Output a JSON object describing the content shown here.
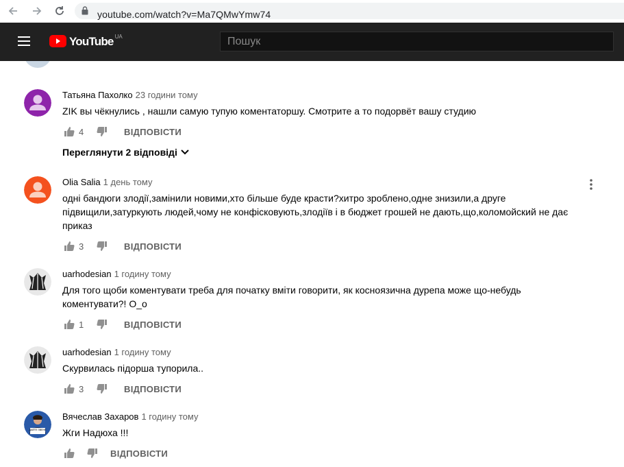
{
  "browser": {
    "url": "youtube.com/watch?v=Ma7QMwYmw74"
  },
  "header": {
    "logo_text": "YouTube",
    "country_code": "UA",
    "search_placeholder": "Пошук"
  },
  "comments": [
    {
      "author": "Татьяна Пахолко",
      "time": "23 години тому",
      "text": "ZIK вы чёкнулись , нашли самую тупую коментаторшу. Смотрите а то подорвёт вашу студию",
      "likes": "4",
      "reply_label": "ВІДПОВІСТИ",
      "view_replies": "Переглянути 2 відповіді",
      "avatar_color": "#8e24aa"
    },
    {
      "author": "Olia Salia",
      "time": "1 день тому",
      "text": "одні бандюги злодії,замінили новими,хто більше буде красти?хитро зроблено,одне знизили,а друге підвищили,затуркують людей,чому не конфісковують,злодіїв і в бюджет грошей не дають,що,коломойский не дає приказ",
      "likes": "3",
      "reply_label": "ВІДПОВІСТИ",
      "avatar_color": "#f4511e"
    },
    {
      "author": "uarhodesian",
      "time": "1 годину тому",
      "text": "Для того щоби коментувати треба для початку вміти говорити, як косноязична дурепа може що-небудь коментувати?! О_о",
      "likes": "1",
      "reply_label": "ВІДПОВІСТИ"
    },
    {
      "author": "uarhodesian",
      "time": "1 годину тому",
      "text": "Скурвилась підорша тупорила..",
      "likes": "3",
      "reply_label": "ВІДПОВІСТИ"
    },
    {
      "author": "Вячеслав Захаров",
      "time": "1 годину тому",
      "text": "Жги Надюха !!!",
      "likes": "",
      "reply_label": "ВІДПОВІСТИ",
      "avatar_sign_text": "ДАЙТЕ ЗВЕНЕ"
    }
  ]
}
